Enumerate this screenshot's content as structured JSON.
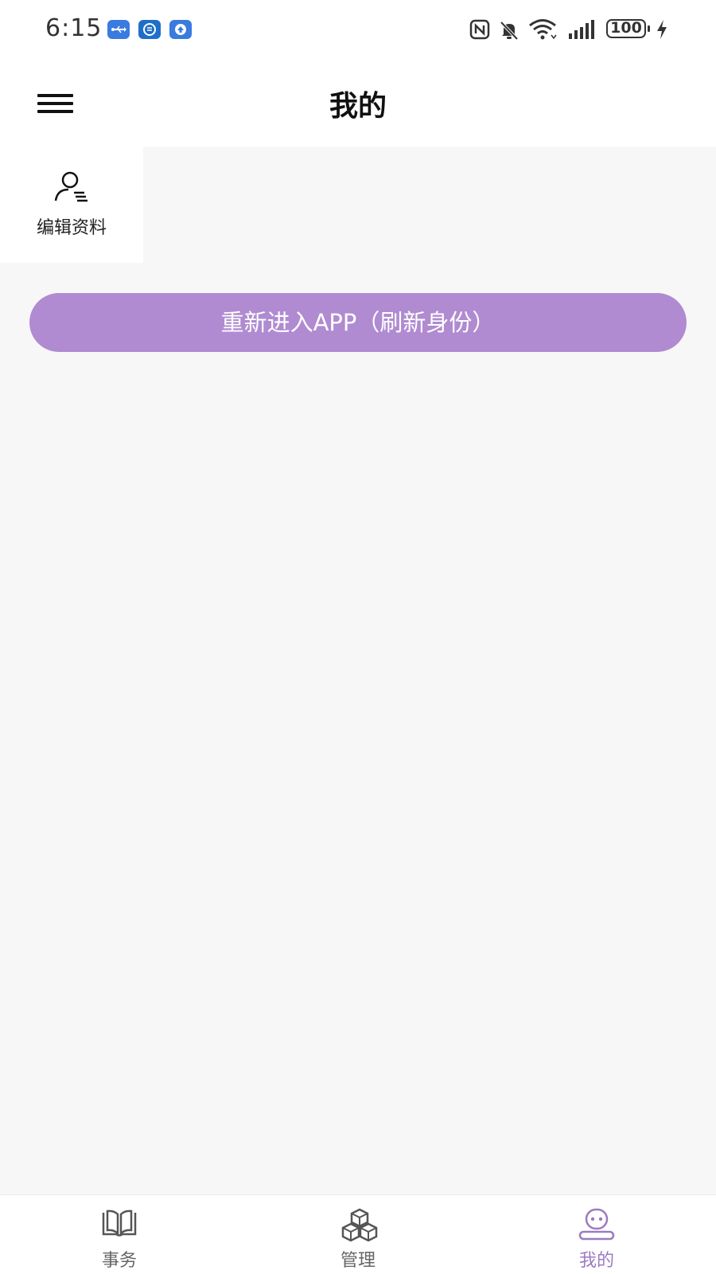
{
  "status_bar": {
    "time": "6:15",
    "notification_icons": [
      "usb-icon",
      "sync-icon",
      "upload-icon"
    ],
    "system_icons": [
      "nfc-icon",
      "bell-muted-icon",
      "wifi-icon",
      "signal-icon",
      "battery-icon",
      "charging-icon"
    ],
    "battery_level": "100"
  },
  "header": {
    "menu_icon": "hamburger-menu-icon",
    "title": "我的"
  },
  "profile_actions": {
    "edit_profile": {
      "icon": "user-edit-icon",
      "label": "编辑资料"
    }
  },
  "refresh_button": {
    "label": "重新进入APP（刷新身份）"
  },
  "bottom_nav": {
    "items": [
      {
        "label": "事务",
        "icon": "book-icon",
        "active": false
      },
      {
        "label": "管理",
        "icon": "cubes-icon",
        "active": false
      },
      {
        "label": "我的",
        "icon": "profile-robot-icon",
        "active": true
      }
    ]
  },
  "colors": {
    "accent": "#b08bd1",
    "active_nav": "#9c7bc2",
    "inactive_nav": "#666666",
    "page_background": "#f7f7f8"
  }
}
